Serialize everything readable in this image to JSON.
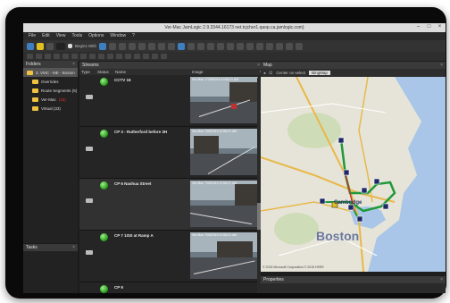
{
  "window": {
    "title": "Ver-Mac JamLogic 2.9.3344.16173 net.tcjcher1.qaop.ca.jamlogic.com)"
  },
  "menu": [
    "File",
    "Edit",
    "View",
    "Tools",
    "Options",
    "Window",
    "?"
  ],
  "toolbar": {
    "checkbox_label": "Begins With"
  },
  "folders": {
    "title": "Folders",
    "items": [
      {
        "label": "3. VMC - ME - Boston",
        "selected": true
      },
      {
        "label": "Overrides"
      },
      {
        "label": "Route Segments (6)"
      },
      {
        "label": "Ver-Mac",
        "tag": "(15)"
      },
      {
        "label": "Virtual (33)"
      }
    ]
  },
  "tasks": {
    "title": "Tasks"
  },
  "streams": {
    "title": "Streams",
    "columns": [
      "Type",
      "Status",
      "Name",
      "Image",
      "Vehicle"
    ],
    "rows": [
      {
        "name": "CCTV 16",
        "stamp": "Ver-Mac 17/06/2015 10:56:21 AM"
      },
      {
        "name": "CP 3 - Rutherford before 3H",
        "stamp": "Ver-Mac 7/06/2015 10:56:21 AM"
      },
      {
        "name": "CP 6 Nashua Street",
        "stamp": "Ver-Mac 7/06/2015 10:56:21 AM"
      },
      {
        "name": "CP 7 1IS0 at Ramp A",
        "stamp": "Ver-Mac 7/06/2015 10:56:21 AM"
      },
      {
        "name": "CP 9",
        "stamp": ""
      }
    ]
  },
  "map": {
    "title": "Map",
    "center_label": "Center on select",
    "provider": "BingMap",
    "cities": {
      "cambridge": "Cambridge",
      "boston": "Boston"
    },
    "copyright": "© 2015 Microsoft Corporation © 2015 HERE"
  },
  "properties": {
    "title": "Properties"
  },
  "colors": {
    "status_ok": "#2a9e1e",
    "accent": "#e0c020",
    "route": "#1f9a3a"
  }
}
